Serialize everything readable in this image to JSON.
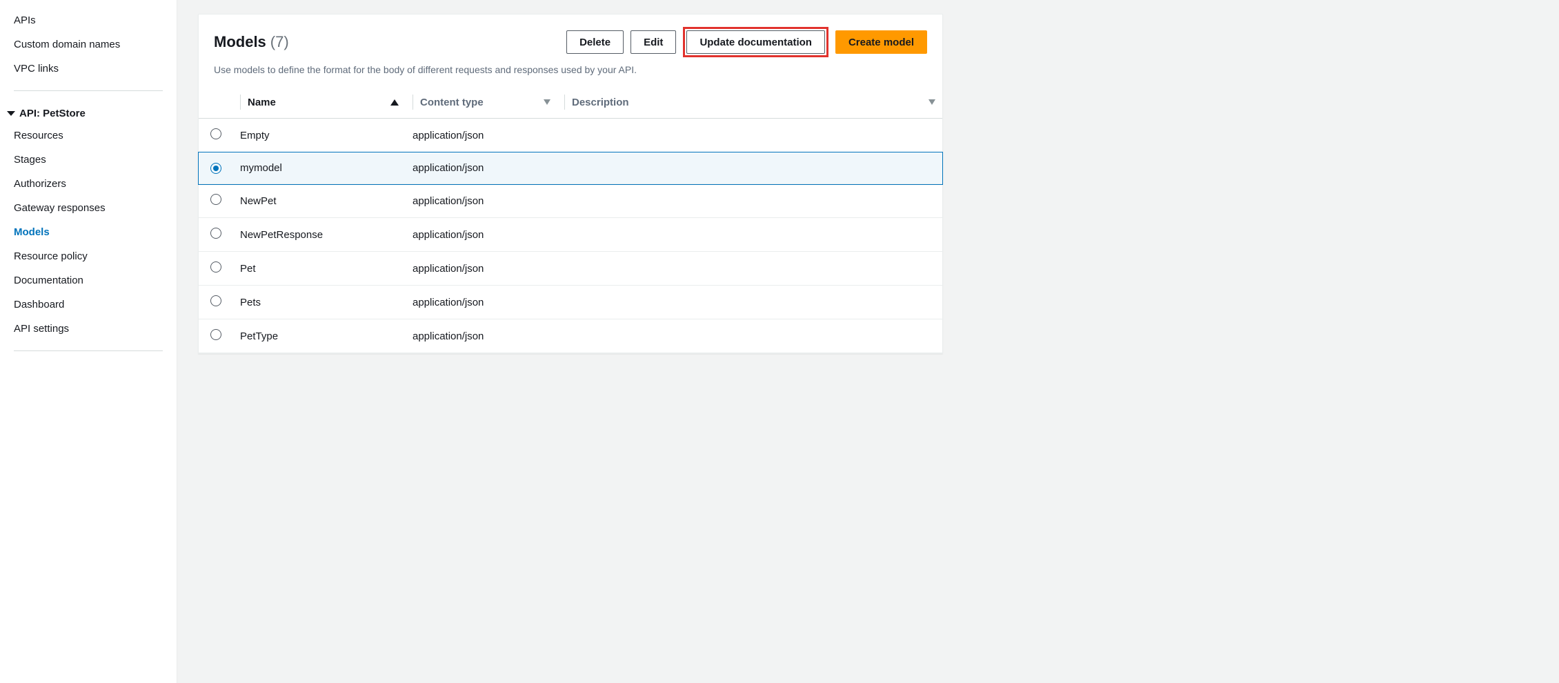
{
  "sidebar": {
    "top_items": [
      {
        "label": "APIs"
      },
      {
        "label": "Custom domain names"
      },
      {
        "label": "VPC links"
      }
    ],
    "api_heading": "API: PetStore",
    "api_items": [
      {
        "label": "Resources",
        "active": false
      },
      {
        "label": "Stages",
        "active": false
      },
      {
        "label": "Authorizers",
        "active": false
      },
      {
        "label": "Gateway responses",
        "active": false
      },
      {
        "label": "Models",
        "active": true
      },
      {
        "label": "Resource policy",
        "active": false
      },
      {
        "label": "Documentation",
        "active": false
      },
      {
        "label": "Dashboard",
        "active": false
      },
      {
        "label": "API settings",
        "active": false
      }
    ]
  },
  "panel": {
    "title": "Models",
    "count": "(7)",
    "description": "Use models to define the format for the body of different requests and responses used by your API.",
    "buttons": {
      "delete": "Delete",
      "edit": "Edit",
      "update_doc": "Update documentation",
      "create": "Create model"
    }
  },
  "table": {
    "columns": {
      "name": "Name",
      "content_type": "Content type",
      "description": "Description"
    },
    "rows": [
      {
        "name": "Empty",
        "content_type": "application/json",
        "description": "",
        "selected": false
      },
      {
        "name": "mymodel",
        "content_type": "application/json",
        "description": "",
        "selected": true
      },
      {
        "name": "NewPet",
        "content_type": "application/json",
        "description": "",
        "selected": false
      },
      {
        "name": "NewPetResponse",
        "content_type": "application/json",
        "description": "",
        "selected": false
      },
      {
        "name": "Pet",
        "content_type": "application/json",
        "description": "",
        "selected": false
      },
      {
        "name": "Pets",
        "content_type": "application/json",
        "description": "",
        "selected": false
      },
      {
        "name": "PetType",
        "content_type": "application/json",
        "description": "",
        "selected": false
      }
    ]
  }
}
